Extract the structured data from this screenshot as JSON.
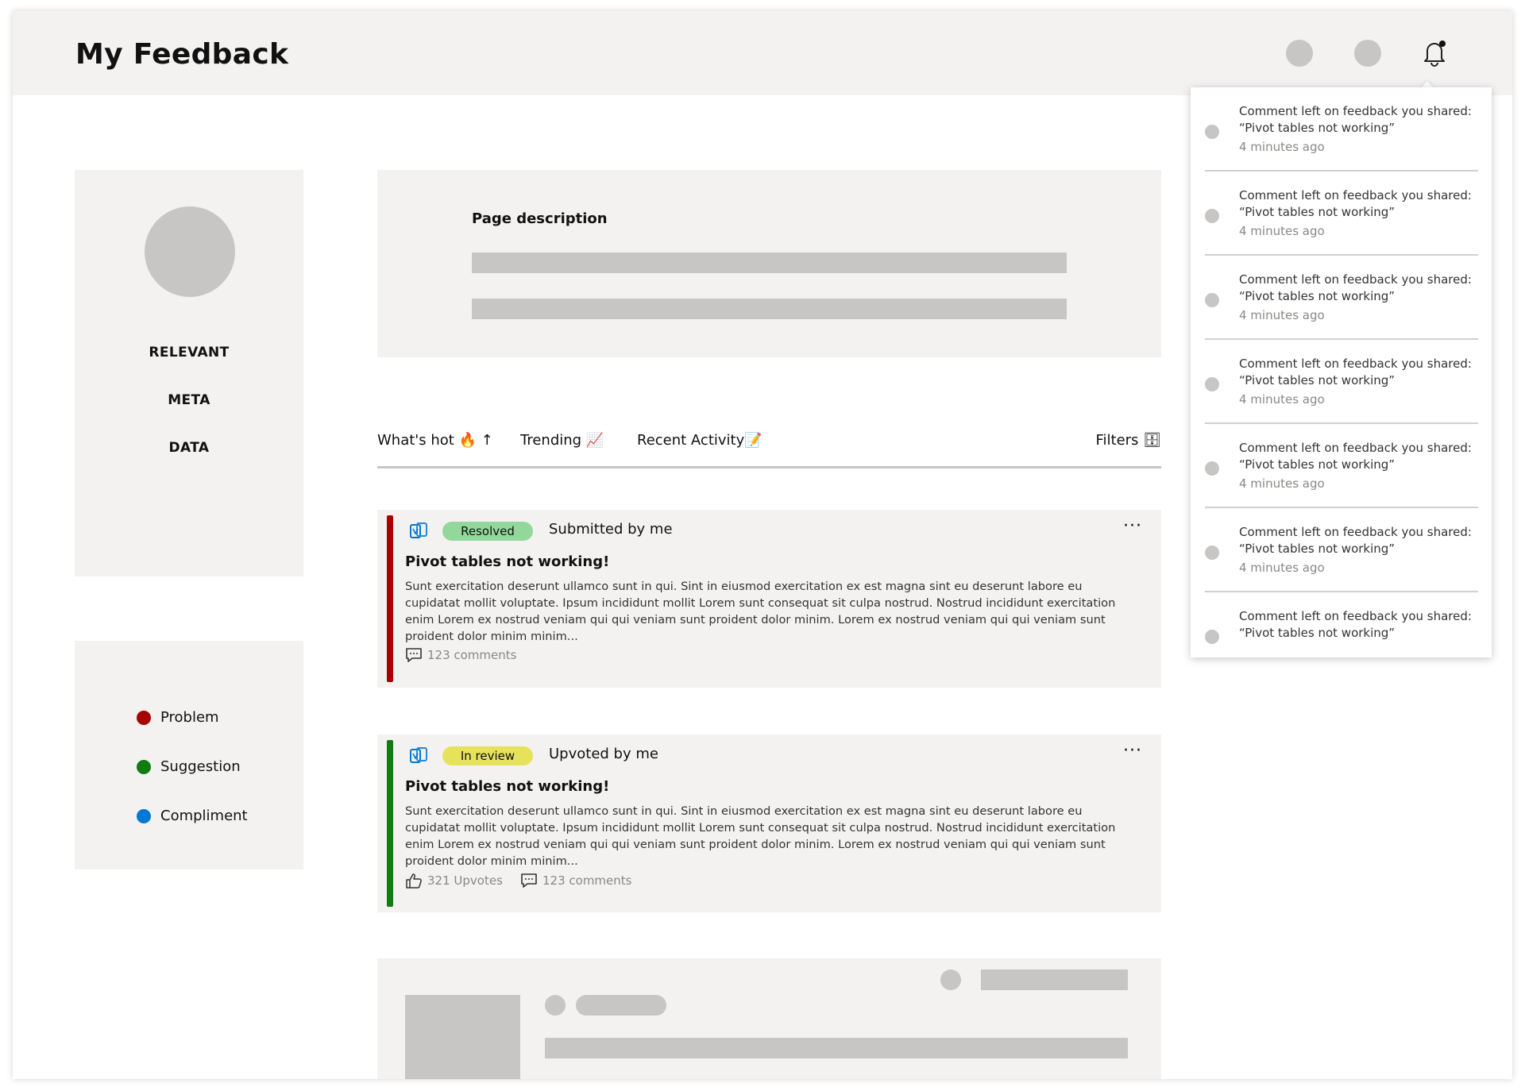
{
  "header": {
    "title": "My Feedback"
  },
  "profile": {
    "meta_lines": [
      "RELEVANT",
      "META",
      "DATA"
    ]
  },
  "legend": {
    "items": [
      {
        "label": "Problem",
        "color": "#a80000"
      },
      {
        "label": "Suggestion",
        "color": "#107c10"
      },
      {
        "label": "Compliment",
        "color": "#0078d4"
      }
    ]
  },
  "description": {
    "title": "Page description"
  },
  "tabs": {
    "whats_hot": "What's hot 🔥 ↑",
    "trending": "Trending 📈",
    "recent_activity": "Recent Activity📝",
    "filters": "Filters 🗄"
  },
  "cards": [
    {
      "category_color": "#a80000",
      "status": "Resolved",
      "status_color": "#92d89a",
      "relation": "Submitted by me",
      "title": "Pivot tables not working!",
      "body": "Sunt exercitation deserunt ullamco sunt in qui. Sint in eiusmod exercitation ex est magna sint eu deserunt labore eu cupidatat mollit voluptate. Ipsum incididunt mollit Lorem sunt consequat sit culpa nostrud. Nostrud incididunt exercitation enim Lorem ex nostrud veniam qui qui veniam sunt proident dolor minim. Lorem ex nostrud veniam qui qui veniam sunt proident dolor minim minim...",
      "comments": "123 comments"
    },
    {
      "category_color": "#107c10",
      "status": "In review",
      "status_color": "#e6e25c",
      "relation": "Upvoted by me",
      "title": "Pivot tables not working!",
      "body": "Sunt exercitation deserunt ullamco sunt in qui. Sint in eiusmod exercitation ex est magna sint eu deserunt labore eu cupidatat mollit voluptate. Ipsum incididunt mollit Lorem sunt consequat sit culpa nostrud. Nostrud incididunt exercitation enim Lorem ex nostrud veniam qui qui veniam sunt proident dolor minim. Lorem ex nostrud veniam qui qui veniam sunt proident dolor minim minim...",
      "upvotes": "321 Upvotes",
      "comments": "123 comments"
    }
  ],
  "notifications": [
    {
      "line1": "Comment left on feedback you shared:",
      "line2": "“Pivot tables not working”",
      "time": "4 minutes ago"
    },
    {
      "line1": "Comment left on feedback you shared:",
      "line2": "“Pivot tables not working”",
      "time": "4 minutes ago"
    },
    {
      "line1": "Comment left on feedback you shared:",
      "line2": "“Pivot tables not working”",
      "time": "4 minutes ago"
    },
    {
      "line1": "Comment left on feedback you shared:",
      "line2": "“Pivot tables not working”",
      "time": "4 minutes ago"
    },
    {
      "line1": "Comment left on feedback you shared:",
      "line2": "“Pivot tables not working”",
      "time": "4 minutes ago"
    },
    {
      "line1": "Comment left on feedback you shared:",
      "line2": "“Pivot tables not working”",
      "time": "4 minutes ago"
    },
    {
      "line1": "Comment left on feedback you shared:",
      "line2": "“Pivot tables not working”",
      "time": ""
    }
  ],
  "icons": {
    "notifications": "bell-icon",
    "feedback_app": "feedback-app-icon",
    "comments": "comment-icon",
    "upvote": "thumbs-up-icon",
    "more": "more-options-icon"
  }
}
